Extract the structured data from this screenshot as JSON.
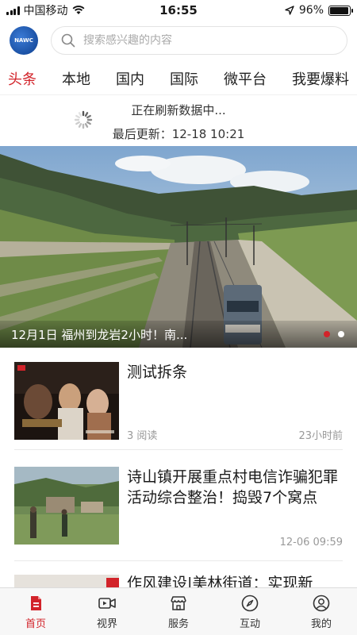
{
  "status_bar": {
    "carrier": "中国移动",
    "time": "16:55",
    "battery": "96%",
    "battery_level": 0.96
  },
  "header": {
    "logo_text": "NAWC",
    "search_placeholder": "搜索感兴趣的内容"
  },
  "tabs": [
    {
      "label": "头条",
      "active": true
    },
    {
      "label": "本地"
    },
    {
      "label": "国内"
    },
    {
      "label": "国际"
    },
    {
      "label": "微平台"
    },
    {
      "label": "我要爆料"
    }
  ],
  "refresh": {
    "status": "正在刷新数据中...",
    "last_update": "最后更新：12-18 10:21"
  },
  "banner": {
    "caption": "12月1日 福州到龙岩2小时！南...",
    "slide_count": 2,
    "active_slide": 1
  },
  "news": [
    {
      "title": "测试拆条",
      "reads": "3 阅读",
      "time": "23小时前"
    },
    {
      "title": "诗山镇开展重点村电信诈骗犯罪活动综合整治！捣毁7个窝点",
      "reads": "",
      "time": "12-06 09:59"
    },
    {
      "title": "作风建设|美林街道：实现新",
      "reads": "",
      "time": ""
    }
  ],
  "bottom_nav": [
    {
      "label": "首页",
      "icon": "home-icon",
      "active": true
    },
    {
      "label": "视界",
      "icon": "video-icon"
    },
    {
      "label": "服务",
      "icon": "store-icon"
    },
    {
      "label": "互动",
      "icon": "compass-icon"
    },
    {
      "label": "我的",
      "icon": "user-icon"
    }
  ],
  "colors": {
    "accent": "#d2232a",
    "text": "#1a1a1a",
    "muted": "#999999"
  }
}
